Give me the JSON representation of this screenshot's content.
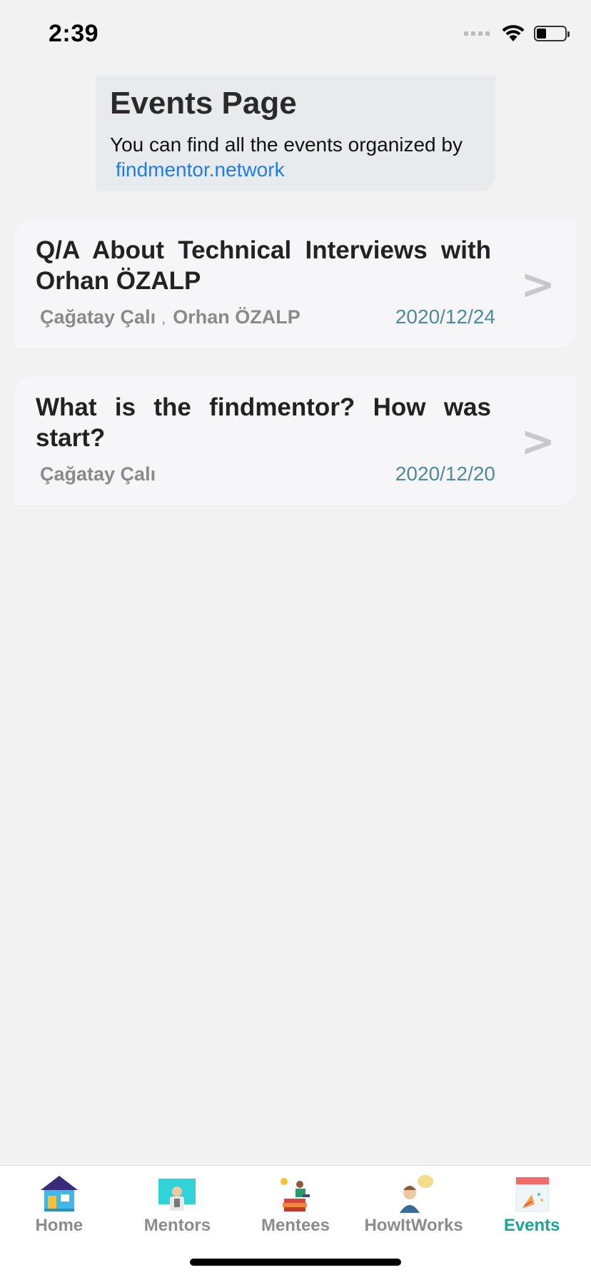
{
  "status_bar": {
    "time": "2:39",
    "battery_level": 0.35
  },
  "header": {
    "title": "Events Page",
    "subtitle": "You can find all the events organized by",
    "link": "findmentor.network"
  },
  "events": [
    {
      "title": " Q/A About Technical Interviews with Orhan ÖZALP",
      "speakers": [
        "Çağatay Çalı",
        "Orhan ÖZALP"
      ],
      "separator": ",",
      "date": "2020/12/24",
      "chevron": ">"
    },
    {
      "title": " What is the findmentor? How was start?",
      "speakers": [
        "Çağatay Çalı"
      ],
      "date": "2020/12/20",
      "chevron": ">"
    }
  ],
  "tab_bar": {
    "tabs": [
      {
        "label": "Home",
        "icon": "home-icon"
      },
      {
        "label": "Mentors",
        "icon": "mentor-icon"
      },
      {
        "label": "Mentees",
        "icon": "mentee-icon"
      },
      {
        "label": "HowItWorks",
        "icon": "how-it-works-icon"
      },
      {
        "label": "Events",
        "icon": "events-icon",
        "active": true
      }
    ],
    "active_color": "#1aa594",
    "inactive_color": "#8c8c8c"
  },
  "colors": {
    "background": "#f2f2f2",
    "link": "#1d7ee8",
    "date": "#4e8a97"
  }
}
